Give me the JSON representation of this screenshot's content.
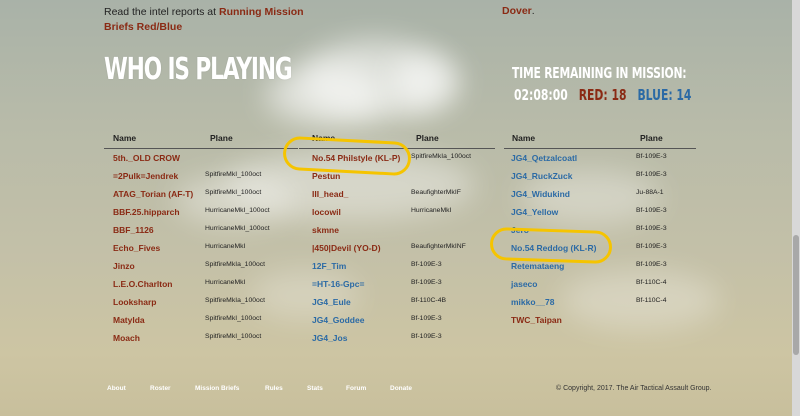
{
  "intro": {
    "text": "Read the intel reports at ",
    "link": "Running Mission Briefs Red/Blue",
    "dover": "Dover",
    "dover_suffix": "."
  },
  "heading": "WHO IS PLAYING",
  "mission": {
    "label": "TIME REMAINING IN MISSION:",
    "time": "02:08:00",
    "red_label": "RED:",
    "red_count": "18",
    "blue_label": "BLUE:",
    "blue_count": "14"
  },
  "headers": {
    "name": "Name",
    "plane": "Plane"
  },
  "tables": [
    {
      "rows": [
        {
          "name": "5th._OLD CROW",
          "plane": "",
          "side": "red"
        },
        {
          "name": "=2Pulk=Jendrek",
          "plane": "SpitfireMkI_100oct",
          "side": "red"
        },
        {
          "name": "ATAG_Torian (AF-T)",
          "plane": "SpitfireMkI_100oct",
          "side": "red"
        },
        {
          "name": "BBF.25.hipparch",
          "plane": "HurricaneMkI_100oct",
          "side": "red"
        },
        {
          "name": "BBF_1126",
          "plane": "HurricaneMkI_100oct",
          "side": "red"
        },
        {
          "name": "Echo_Fives",
          "plane": "HurricaneMkI",
          "side": "red"
        },
        {
          "name": "Jinzo",
          "plane": "SpitfireMkIa_100oct",
          "side": "red"
        },
        {
          "name": "L.E.O.Charlton",
          "plane": "HurricaneMkI",
          "side": "red"
        },
        {
          "name": "Looksharp",
          "plane": "SpitfireMkIa_100oct",
          "side": "red"
        },
        {
          "name": "Matylda",
          "plane": "SpitfireMkI_100oct",
          "side": "red"
        },
        {
          "name": "Moach",
          "plane": "SpitfireMkI_100oct",
          "side": "red"
        }
      ]
    },
    {
      "rows": [
        {
          "name": "No.54 Philstyle (KL-P)",
          "plane": "SpitfireMkIa_100oct",
          "side": "red"
        },
        {
          "name": "Pestun",
          "plane": "",
          "side": "red"
        },
        {
          "name": "III_head_",
          "plane": "BeaufighterMkIF",
          "side": "red"
        },
        {
          "name": "locowil",
          "plane": "HurricaneMkI",
          "side": "red"
        },
        {
          "name": "skmne",
          "plane": "",
          "side": "red"
        },
        {
          "name": "|450|Devil (YO-D)",
          "plane": "BeaufighterMkINF",
          "side": "red"
        },
        {
          "name": "12F_Tim",
          "plane": "Bf-109E-3",
          "side": "blue"
        },
        {
          "name": "=HT-16-Gpc=",
          "plane": "Bf-109E-3",
          "side": "blue"
        },
        {
          "name": "JG4_Eule",
          "plane": "Bf-110C-4B",
          "side": "blue"
        },
        {
          "name": "JG4_Goddee",
          "plane": "Bf-109E-3",
          "side": "blue"
        },
        {
          "name": "JG4_Jos",
          "plane": "Bf-109E-3",
          "side": "blue"
        }
      ]
    },
    {
      "rows": [
        {
          "name": "JG4_Qetzalcoatl",
          "plane": "Bf-109E-3",
          "side": "blue"
        },
        {
          "name": "JG4_RuckZuck",
          "plane": "Bf-109E-3",
          "side": "blue"
        },
        {
          "name": "JG4_Widukind",
          "plane": "Ju-88A-1",
          "side": "blue"
        },
        {
          "name": "JG4_Yellow",
          "plane": "Bf-109E-3",
          "side": "blue"
        },
        {
          "name": "Jero",
          "plane": "Bf-109E-3",
          "side": "blue"
        },
        {
          "name": "No.54 Reddog (KL-R)",
          "plane": "Bf-109E-3",
          "side": "blue"
        },
        {
          "name": "Retemataeng",
          "plane": "Bf-109E-3",
          "side": "blue"
        },
        {
          "name": "jaseco",
          "plane": "Bf-110C-4",
          "side": "blue"
        },
        {
          "name": "mikko__78",
          "plane": "Bf-110C-4",
          "side": "blue"
        },
        {
          "name": "TWC_Taipan",
          "plane": "",
          "side": "red"
        }
      ]
    }
  ],
  "footer": {
    "links": [
      "About",
      "Roster",
      "Mission Briefs",
      "Rules",
      "Stats",
      "Forum",
      "Donate"
    ],
    "copyright": "© Copyright, 2017. The Air Tactical Assault Group."
  },
  "colors": {
    "red": "#8a2a14",
    "blue": "#2b6aa5",
    "highlight": "#f5c400"
  }
}
